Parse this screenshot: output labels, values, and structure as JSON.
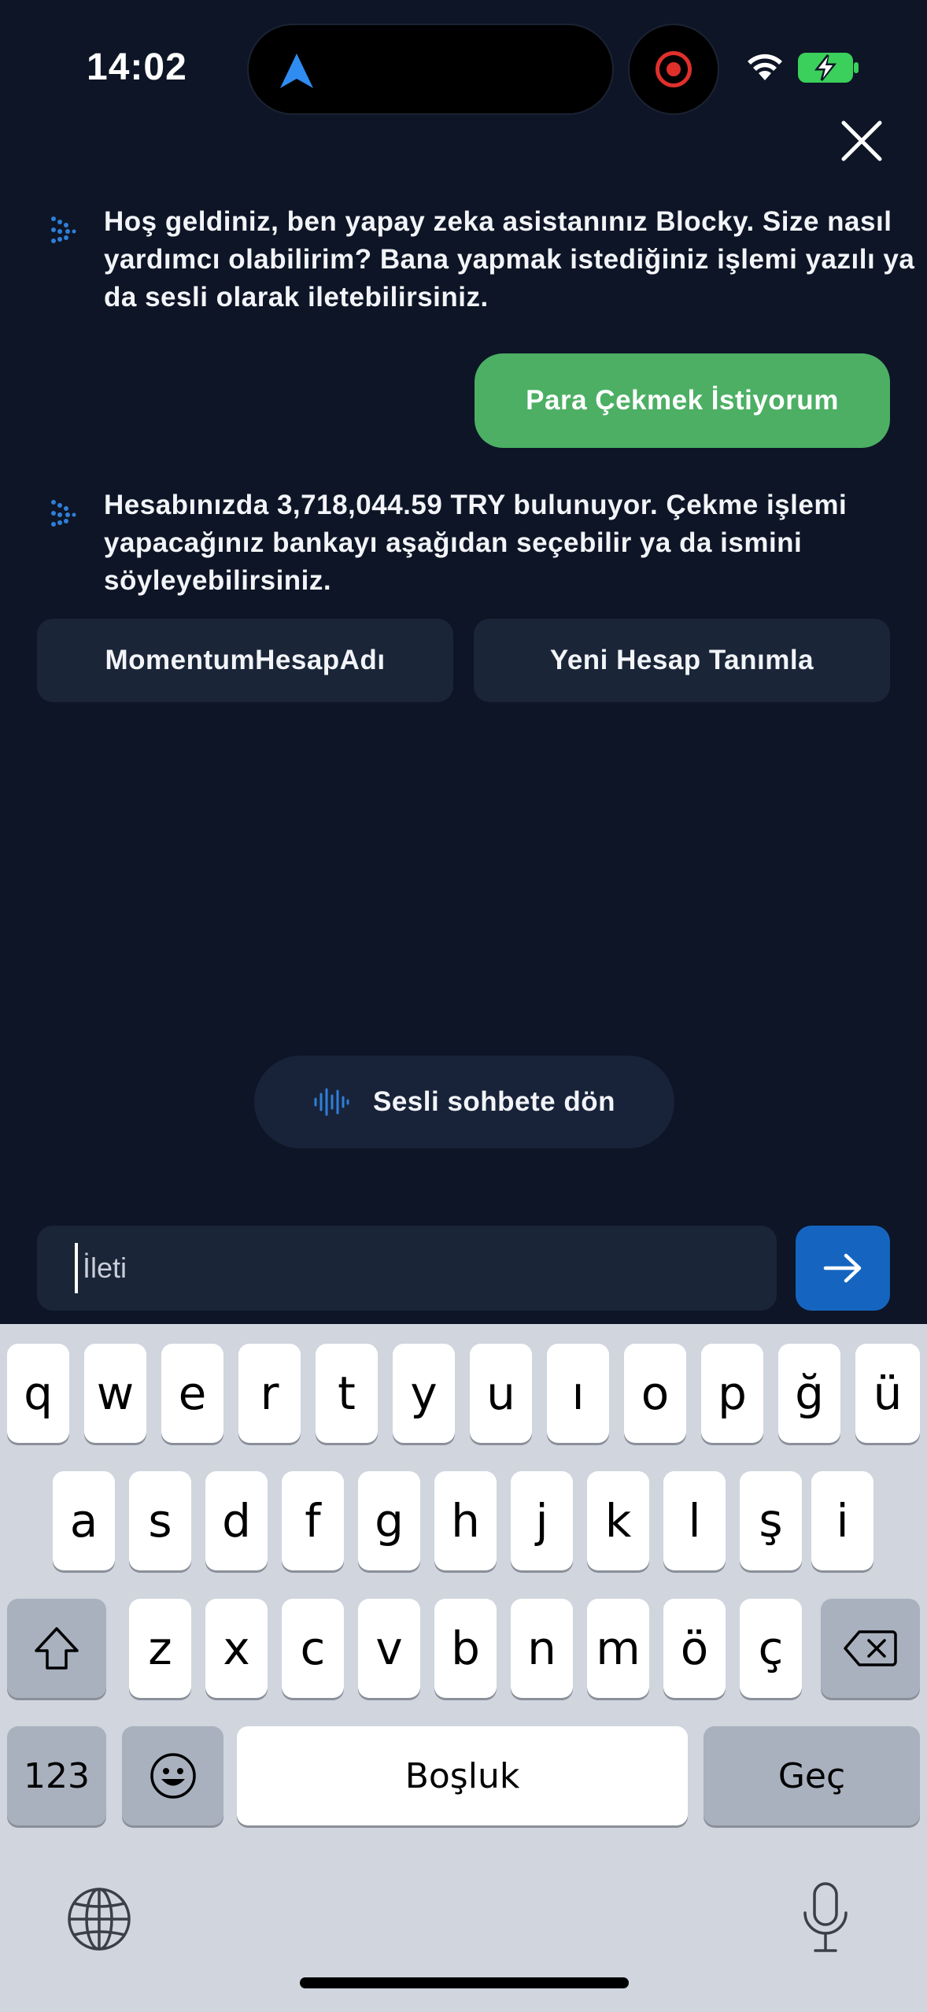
{
  "status_bar": {
    "time": "14:02"
  },
  "messages": {
    "bot_1": "Hoş geldiniz, ben yapay zeka asistanınız Blocky. Size nasıl yardımcı olabilirim? Bana yapmak istediğiniz işlemi yazılı ya da sesli olarak iletebilirsiniz.",
    "user_1": "Para Çekmek İstiyorum",
    "bot_2": "Hesabınızda 3,718,044.59 TRY bulunuyor. Çekme işlemi yapacağınız bankayı aşağıdan seçebilir ya da ismini söyleyebilirsiniz."
  },
  "choices": [
    "MomentumHesapAdı",
    "Yeni Hesap Tanımla"
  ],
  "voice_button": "Sesli sohbete dön",
  "input": {
    "value": "İleti"
  },
  "keyboard": {
    "row1": [
      "q",
      "w",
      "e",
      "r",
      "t",
      "y",
      "u",
      "ı",
      "o",
      "p",
      "ğ",
      "ü"
    ],
    "row2": [
      "a",
      "s",
      "d",
      "f",
      "g",
      "h",
      "j",
      "k",
      "l",
      "ş",
      "i"
    ],
    "row3": [
      "z",
      "x",
      "c",
      "v",
      "b",
      "n",
      "m",
      "ö",
      "ç"
    ],
    "numbers_key": "123",
    "space_key": "Boşluk",
    "return_key": "Geç"
  },
  "colors": {
    "background": "#0d1526",
    "user_bubble": "#4caf64",
    "send_button": "#1565c0",
    "accent_blue": "#2f7fd8"
  }
}
